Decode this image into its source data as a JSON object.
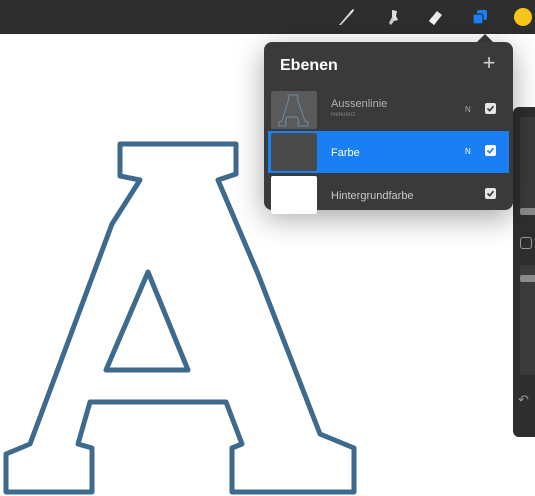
{
  "toolbar": {
    "tools": [
      {
        "icon": "brush-icon"
      },
      {
        "icon": "smudge-icon"
      },
      {
        "icon": "eraser-icon"
      },
      {
        "icon": "layers-icon",
        "active": true,
        "color": "#1a7ef5"
      },
      {
        "icon": "color-icon",
        "color": "#f5c518"
      }
    ]
  },
  "layers_panel": {
    "title": "Ebenen",
    "add_label": "+",
    "layers": [
      {
        "name": "Aussenlinie",
        "subtitle": "Referenz",
        "blend": "N",
        "visible": true
      },
      {
        "name": "Farbe",
        "blend": "N",
        "visible": true,
        "selected": true
      },
      {
        "name": "Hintergrundfarbe",
        "visible": true
      }
    ]
  },
  "colors": {
    "accent": "#1a7ef5",
    "letter_outline": "#3e6a8e",
    "panel_bg": "#3a3a3a",
    "toolbar_bg": "#2e2e2e"
  }
}
